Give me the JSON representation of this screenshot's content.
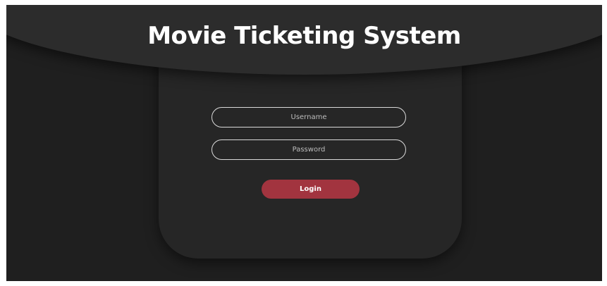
{
  "app": {
    "title": "Movie Ticketing System"
  },
  "login_form": {
    "username": {
      "placeholder": "Username",
      "value": ""
    },
    "password": {
      "placeholder": "Password",
      "value": ""
    },
    "login_label": "Login"
  },
  "colors": {
    "background": "#1f1f1f",
    "header": "#2c2c2c",
    "card": "#262626",
    "accent": "#a2343f",
    "text": "#ffffff"
  }
}
